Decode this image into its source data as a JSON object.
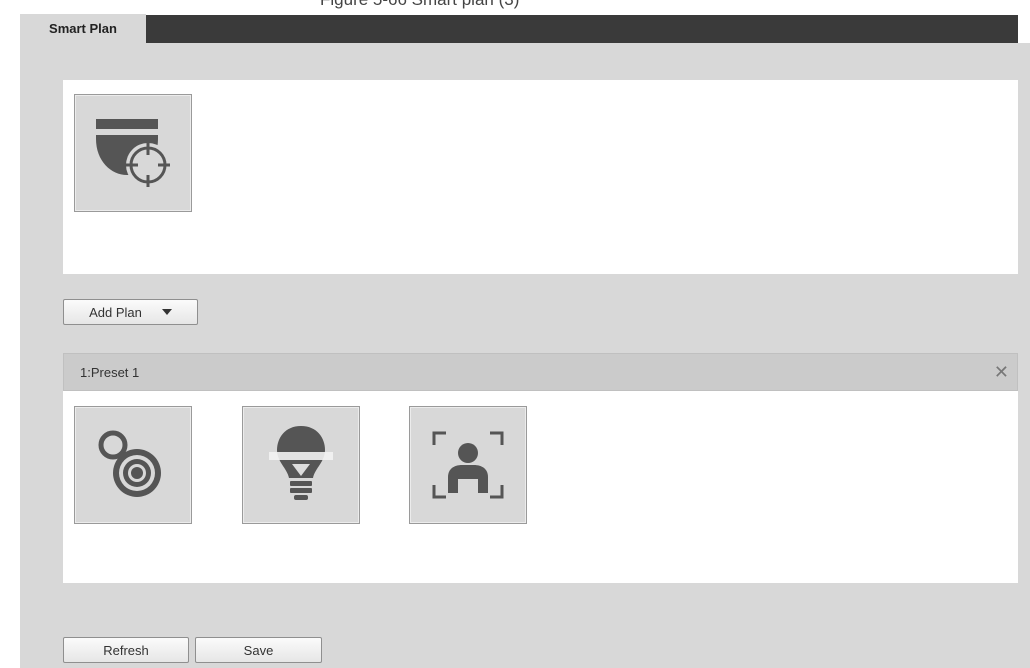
{
  "caption": "Figure 5-66 Smart plan (3)",
  "tabs": [
    {
      "label": "Smart Plan"
    }
  ],
  "ability_icons": [
    {
      "icon": "dome-camera-target-icon"
    }
  ],
  "add_plan": {
    "label": "Add Plan"
  },
  "plans": [
    {
      "title": "1:Preset 1",
      "icons": [
        "radar-camera-icon",
        "light-bulb-icon",
        "face-detection-icon"
      ]
    }
  ],
  "footer": {
    "refresh_label": "Refresh",
    "save_label": "Save"
  }
}
